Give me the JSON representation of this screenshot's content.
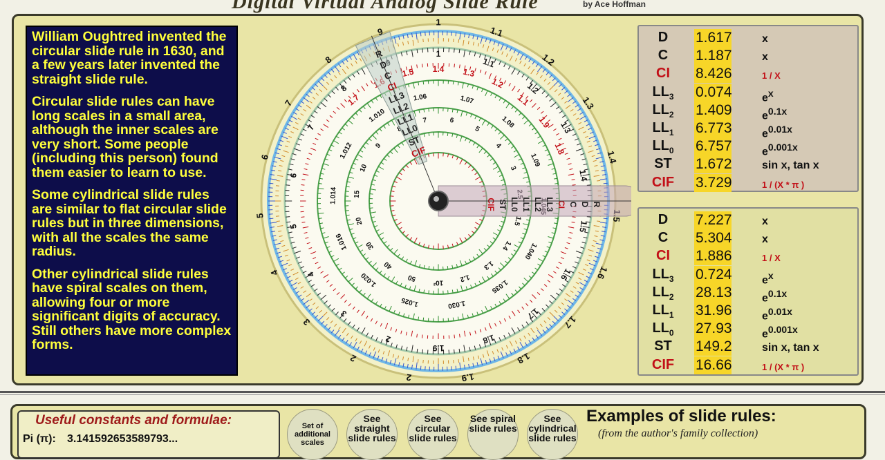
{
  "header": {
    "title": "Digital Virtual Analog Slide Rule",
    "byline": "by Ace Hoffman"
  },
  "story": [
    "William Oughtred invented the circular slide rule in 1630, and a few years later invented the straight slide rule.",
    "Circular slide rules can have long scales in a small area, although the inner scales are very short. Some people (including this person) found them easier to learn to use.",
    "Some cylindrical slide rules are similar to flat circular slide rules but in three dimensions, with all the scales the same radius.",
    "Other cylindrical slide rules have spiral scales on them, allowing four or more significant digits of accuracy. Still others have more complex forms."
  ],
  "colors": {
    "panel_bg": "#e9e5a6",
    "story_bg": "#0d0d4a",
    "story_text": "#ffff3c",
    "readout_bg": "#f7d628",
    "red_scale": "#c20f17"
  },
  "readouts_top": [
    {
      "name": "D",
      "sub": "",
      "value": "1.617",
      "formula": "x",
      "sup": "",
      "red": false
    },
    {
      "name": "C",
      "sub": "",
      "value": "1.187",
      "formula": "x",
      "sup": "",
      "red": false
    },
    {
      "name": "CI",
      "sub": "",
      "value": "8.426",
      "formula": "1 / X",
      "sup": "",
      "red": true
    },
    {
      "name": "LL",
      "sub": "3",
      "value": "0.074",
      "formula": "e",
      "sup": "x",
      "red": false
    },
    {
      "name": "LL",
      "sub": "2",
      "value": "1.409",
      "formula": "e",
      "sup": "0.1x",
      "red": false
    },
    {
      "name": "LL",
      "sub": "1",
      "value": "6.773",
      "formula": "e",
      "sup": "0.01x",
      "red": false
    },
    {
      "name": "LL",
      "sub": "0",
      "value": "6.757",
      "formula": "e",
      "sup": "0.001x",
      "red": false
    },
    {
      "name": "ST",
      "sub": "",
      "value": "1.672",
      "formula": "sin x, tan x",
      "sup": "",
      "red": false
    },
    {
      "name": "CIF",
      "sub": "",
      "value": "3.729",
      "formula": "1 / (X * π )",
      "sup": "",
      "red": true
    }
  ],
  "readouts_bottom": [
    {
      "name": "D",
      "sub": "",
      "value": "7.227",
      "formula": "x",
      "sup": "",
      "red": false
    },
    {
      "name": "C",
      "sub": "",
      "value": "5.304",
      "formula": "x",
      "sup": "",
      "red": false
    },
    {
      "name": "CI",
      "sub": "",
      "value": "1.886",
      "formula": "1 / X",
      "sup": "",
      "red": true
    },
    {
      "name": "LL",
      "sub": "3",
      "value": "0.724",
      "formula": "e",
      "sup": "x",
      "red": false
    },
    {
      "name": "LL",
      "sub": "2",
      "value": "28.13",
      "formula": "e",
      "sup": "0.1x",
      "red": false
    },
    {
      "name": "LL",
      "sub": "1",
      "value": "31.96",
      "formula": "e",
      "sup": "0.01x",
      "red": false
    },
    {
      "name": "LL",
      "sub": "0",
      "value": "27.93",
      "formula": "e",
      "sup": "0.001x",
      "red": false
    },
    {
      "name": "ST",
      "sub": "",
      "value": "149.2",
      "formula": "sin x, tan x",
      "sup": "",
      "red": false
    },
    {
      "name": "CIF",
      "sub": "",
      "value": "16.66",
      "formula": "1 / (X * π )",
      "sup": "",
      "red": true
    }
  ],
  "slide_rule": {
    "outer_d_labels": [
      "1",
      "1.1",
      "1.2",
      "1.3",
      "1.4",
      "1.5",
      "1.6",
      "1.7",
      "1.8",
      "1.9",
      "2",
      "2",
      "3",
      "4",
      "5",
      "6",
      "7",
      "8",
      "9"
    ],
    "scale_letters": [
      "R",
      "D",
      "C",
      "CI",
      "LL3",
      "LL2",
      "LL1",
      "LL0",
      "ST",
      "CIF"
    ],
    "inner_c_labels": [
      "1",
      "1.1",
      "1.2",
      "1.3",
      "1.4",
      "1.5",
      "1.6",
      "1.7",
      "1.8",
      "1.9",
      "2",
      "3",
      "4",
      "5",
      "6",
      "7",
      "8",
      "9"
    ],
    "ci_labels": [
      "1.7",
      "1.6",
      "1.5",
      "1.4",
      "1.3",
      "1.2",
      "1.1",
      "1.9",
      "1.8"
    ],
    "ll_labels": [
      "1.06",
      "1.07",
      "1.08",
      "1.09",
      "1.045",
      "1.040",
      "1.035",
      "1.030",
      "1.025",
      "1.020",
      "1.016",
      "1.014",
      "1.012",
      "1.010"
    ],
    "big_ll_labels": [
      "10²",
      "50",
      "40",
      "30",
      "20",
      "15",
      "10",
      "9",
      "8",
      "7",
      "6",
      "5",
      "4",
      "3",
      "2.5",
      "1.5",
      "1.4",
      "1.3",
      "1.2"
    ]
  },
  "bottom": {
    "constants_title": "Useful constants and formulae:",
    "pi_label": "Pi (π):",
    "pi_value": "3.141592653589793...",
    "buttons": [
      {
        "label": "Set of additional scales"
      },
      {
        "label": "See straight slide rules"
      },
      {
        "label": "See circular slide rules"
      },
      {
        "label": "See spiral slide rules"
      },
      {
        "label": "See cylindrical slide rules"
      }
    ],
    "examples_title": "Examples of slide rules:",
    "examples_subtitle": "(from the author's family collection)"
  }
}
